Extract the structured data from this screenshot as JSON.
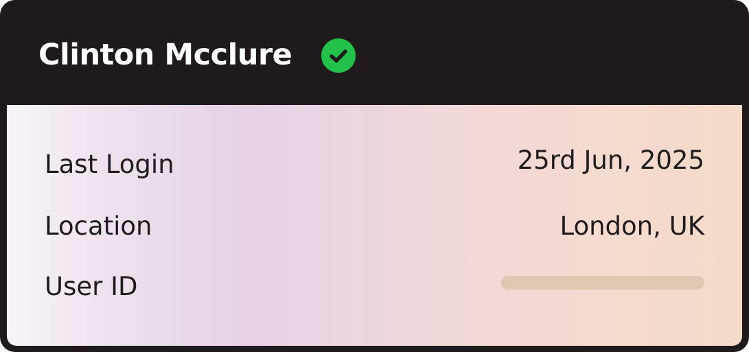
{
  "user": {
    "name": "Clinton Mcclure",
    "verified_icon": "check-circle-icon",
    "verified_color": "#22c24a"
  },
  "details": {
    "last_login": {
      "label": "Last Login",
      "value": "25rd Jun, 2025"
    },
    "location": {
      "label": "Location",
      "value": "London, UK"
    },
    "user_id": {
      "label": "User ID",
      "value_state": "loading-placeholder"
    }
  },
  "colors": {
    "header_bg": "#1f1b1d",
    "text": "#1f1b1d",
    "placeholder": "#dfc7b2"
  }
}
